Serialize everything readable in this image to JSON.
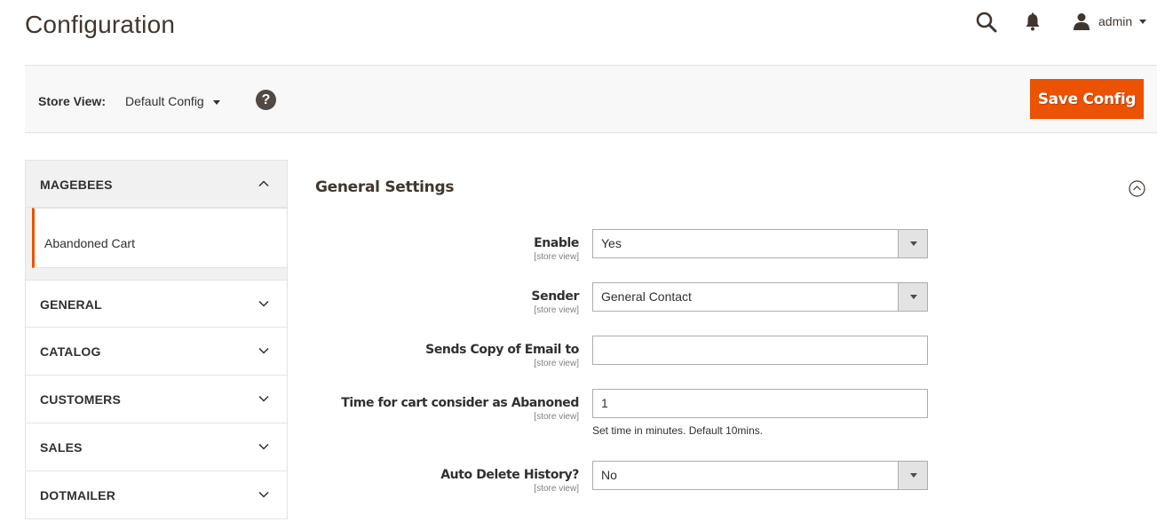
{
  "header": {
    "title": "Configuration",
    "user_name": "admin",
    "icons": {
      "search": "search-icon",
      "notifications": "bell-icon",
      "user": "user-icon"
    }
  },
  "toolbar": {
    "store_view_label": "Store View:",
    "store_view_value": "Default Config",
    "help_symbol": "?",
    "save_label": "Save Config"
  },
  "colors": {
    "accent": "#eb5202",
    "text": "#303030",
    "toolbar_bg": "#f8f8f8"
  },
  "sidebar": {
    "sections": [
      {
        "label": "MAGEBEES",
        "expanded": true,
        "items": [
          {
            "label": "Abandoned Cart",
            "active": true
          }
        ]
      },
      {
        "label": "GENERAL",
        "expanded": false
      },
      {
        "label": "CATALOG",
        "expanded": false
      },
      {
        "label": "CUSTOMERS",
        "expanded": false
      },
      {
        "label": "SALES",
        "expanded": false
      },
      {
        "label": "DOTMAILER",
        "expanded": false
      }
    ]
  },
  "main": {
    "section_title": "General Settings",
    "fields": [
      {
        "label": "Enable",
        "scope": "[store view]",
        "type": "select",
        "value": "Yes"
      },
      {
        "label": "Sender",
        "scope": "[store view]",
        "type": "select",
        "value": "General Contact"
      },
      {
        "label": "Sends Copy of Email to",
        "scope": "[store view]",
        "type": "text",
        "value": ""
      },
      {
        "label": "Time for cart consider as Abanoned",
        "scope": "[store view]",
        "type": "text",
        "value": "1",
        "note": "Set time in minutes. Default 10mins."
      },
      {
        "label": "Auto Delete History?",
        "scope": "[store view]",
        "type": "select",
        "value": "No"
      }
    ]
  }
}
